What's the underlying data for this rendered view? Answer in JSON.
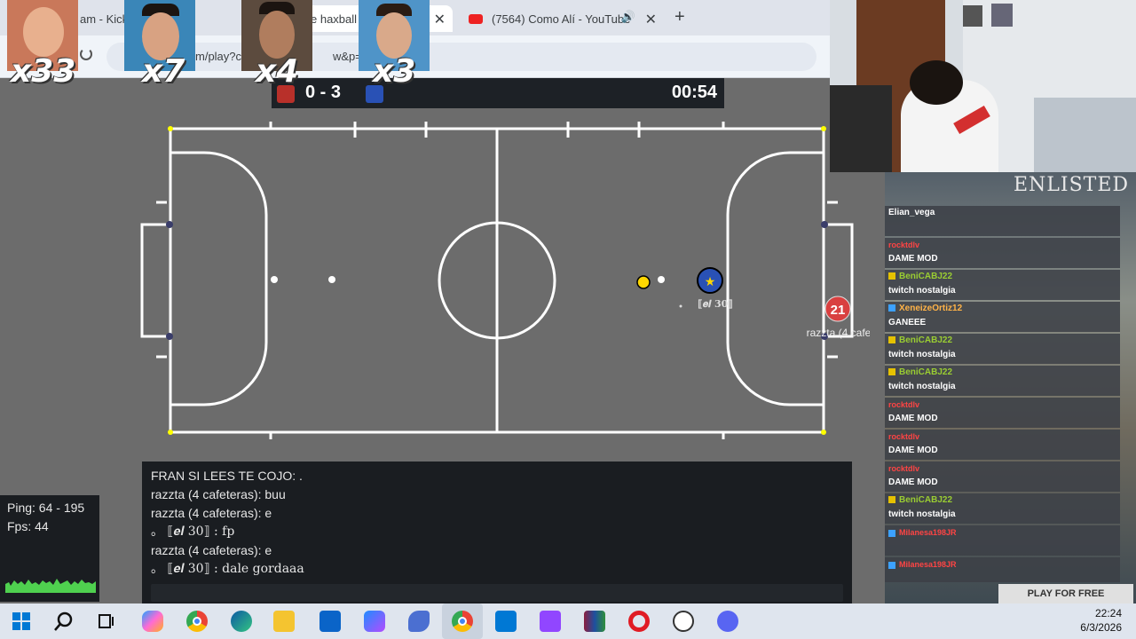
{
  "browser": {
    "tabs": [
      {
        "label": "am - Kick"
      },
      {
        "label": "e haxball"
      },
      {
        "label": "(7564) Como Alí - YouTube"
      }
    ],
    "new_tab_label": "+",
    "close_label": "✕",
    "url": "m/play?c",
    "url_tail": "w&p=1"
  },
  "webcam_players": [
    {
      "label": "x33"
    },
    {
      "label": "x7"
    },
    {
      "label": "x4"
    },
    {
      "label": "x3"
    }
  ],
  "game": {
    "score": "0 - 3",
    "timer": "00:54",
    "player_blue_number": "",
    "player_blue_name": "⟦𝒆𝒍 30⟧",
    "player_red_number": "21",
    "player_red_name": "razzta (4 cafe",
    "colors": {
      "red": "#c8302a",
      "blue": "#2951b5",
      "ball": "#ffd700",
      "pitch": "#6c6c6c",
      "lines": "#ffffff"
    }
  },
  "chat": {
    "lines": [
      "FRAN SI LEES TE COJO: .",
      "razzta (4 cafeteras): buu",
      "razzta (4 cafeteras): e",
      "。 ⟦𝒆𝒍 30⟧ : fp",
      "razzta (4 cafeteras): e",
      "。 ⟦𝒆𝒍 30⟧ : dale gordaaa"
    ]
  },
  "stats": {
    "ping": "Ping: 64 - 195",
    "fps": "Fps: 44"
  },
  "stream_chat": {
    "ad_title": "ENLISTED",
    "ad_button": "PLAY FOR FREE",
    "messages": [
      {
        "user": "Elian_vega",
        "text": "",
        "color": "#ffffff"
      },
      {
        "user": "rocktdlv",
        "text": "DAME MOD",
        "color": "#ff4444"
      },
      {
        "user": "BeniCABJ22",
        "text": "twitch nostalgia",
        "color": "#9acd32"
      },
      {
        "user": "XeneizeOrtiz12",
        "text": "GANEEE",
        "color": "#ffb347"
      },
      {
        "user": "BeniCABJ22",
        "text": "twitch nostalgia",
        "color": "#9acd32"
      },
      {
        "user": "BeniCABJ22",
        "text": "twitch nostalgia",
        "color": "#9acd32"
      },
      {
        "user": "rocktdlv",
        "text": "DAME MOD",
        "color": "#ff4444"
      },
      {
        "user": "rocktdlv",
        "text": "DAME MOD",
        "color": "#ff4444"
      },
      {
        "user": "rocktdlv",
        "text": "DAME MOD",
        "color": "#ff4444"
      },
      {
        "user": "BeniCABJ22",
        "text": "twitch nostalgia",
        "color": "#9acd32"
      },
      {
        "user": "Milanesa198JR",
        "text": "",
        "color": "#ff4444"
      },
      {
        "user": "Milanesa198JR",
        "text": "",
        "color": "#ff4444"
      }
    ]
  },
  "taskbar": {
    "time": "22:24",
    "date": "6/3/2026",
    "apps": [
      "windows-start",
      "search",
      "task-view",
      "copilot",
      "chrome",
      "edge",
      "file-explorer",
      "outlook",
      "microsoft-365",
      "feather-app",
      "chrome-active",
      "microsoft-store",
      "twitch",
      "winrar",
      "opera",
      "clock-app",
      "discord"
    ]
  }
}
